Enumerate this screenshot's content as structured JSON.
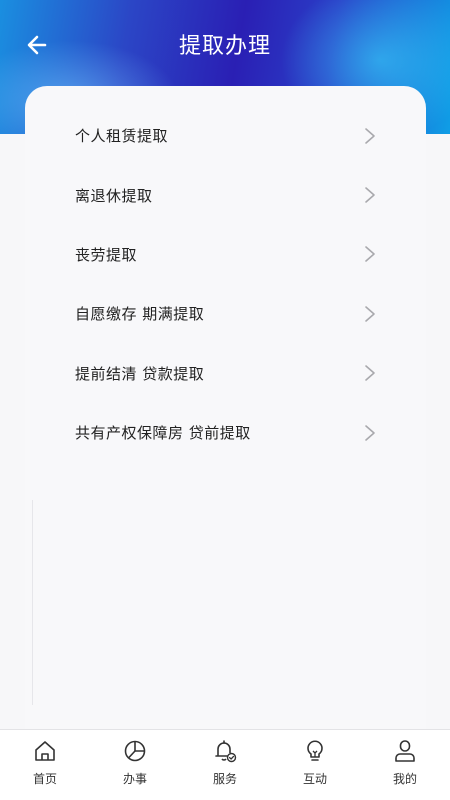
{
  "header": {
    "title": "提取办理",
    "back_icon": "arrow-left-icon",
    "gradient_colors": [
      "#1a8fe0",
      "#2a1fb4",
      "#0f9ee6"
    ]
  },
  "menu": {
    "items": [
      {
        "label": "个人租赁提取",
        "icon": "chevron-right-icon"
      },
      {
        "label": "离退休提取",
        "icon": "chevron-right-icon"
      },
      {
        "label": "丧劳提取",
        "icon": "chevron-right-icon"
      },
      {
        "label": "自愿缴存 期满提取",
        "icon": "chevron-right-icon"
      },
      {
        "label": "提前结清 贷款提取",
        "icon": "chevron-right-icon"
      },
      {
        "label": "共有产权保障房 贷前提取",
        "icon": "chevron-right-icon"
      }
    ]
  },
  "tabbar": {
    "items": [
      {
        "label": "首页",
        "icon": "home-icon"
      },
      {
        "label": "办事",
        "icon": "pie-chart-icon"
      },
      {
        "label": "服务",
        "icon": "bell-check-icon"
      },
      {
        "label": "互动",
        "icon": "lightbulb-icon"
      },
      {
        "label": "我的",
        "icon": "user-icon"
      }
    ]
  }
}
